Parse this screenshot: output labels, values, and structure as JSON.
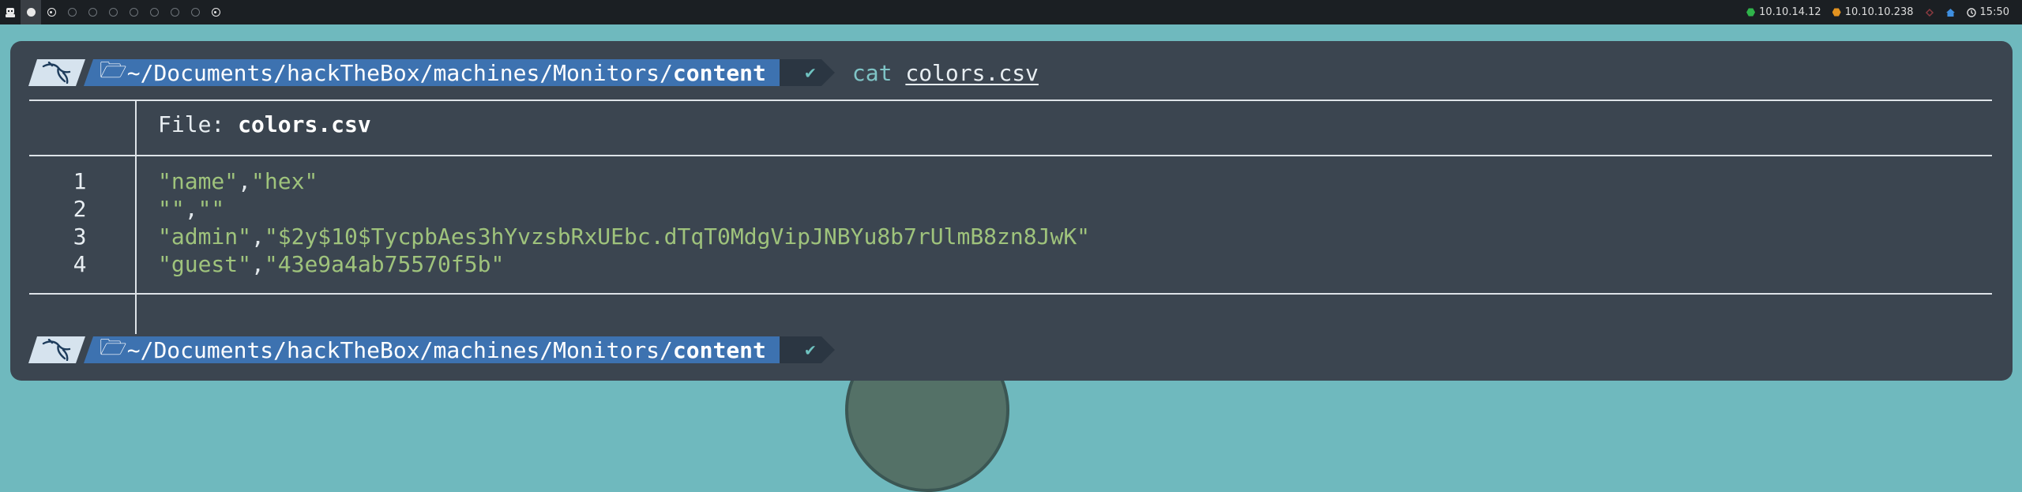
{
  "topbar": {
    "workspaces": [
      {
        "icon": "app-logo-icon",
        "state": "logo"
      },
      {
        "icon": "workspace-1-icon",
        "state": "filled"
      },
      {
        "icon": "workspace-2-icon",
        "state": "ring"
      },
      {
        "icon": "workspace-3-icon",
        "state": "empty"
      },
      {
        "icon": "workspace-4-icon",
        "state": "empty"
      },
      {
        "icon": "workspace-5-icon",
        "state": "empty"
      },
      {
        "icon": "workspace-6-icon",
        "state": "empty"
      },
      {
        "icon": "workspace-7-icon",
        "state": "empty"
      },
      {
        "icon": "workspace-8-icon",
        "state": "empty"
      },
      {
        "icon": "workspace-9-icon",
        "state": "empty"
      },
      {
        "icon": "workspace-10-icon",
        "state": "ring"
      }
    ],
    "local_ip": "10.10.14.12",
    "target_ip": "10.10.10.238",
    "time": "15:50"
  },
  "prompts": [
    {
      "path_prefix": "~/Documents/hackTheBox/machines/Monitors/",
      "path_current": "content",
      "status": "✔",
      "command": "cat",
      "argument": "colors.csv"
    },
    {
      "path_prefix": "~/Documents/hackTheBox/machines/Monitors/",
      "path_current": "content",
      "status": "✔"
    }
  ],
  "output": {
    "file_prefix": "File: ",
    "file_name": "colors.csv",
    "lines": [
      {
        "num": "1",
        "parts": [
          [
            "str",
            "\"name\""
          ],
          [
            "pun",
            ","
          ],
          [
            "str",
            "\"hex\""
          ]
        ]
      },
      {
        "num": "2",
        "parts": [
          [
            "str",
            "\"\""
          ],
          [
            "pun",
            ","
          ],
          [
            "str",
            "\"\""
          ]
        ]
      },
      {
        "num": "3",
        "parts": [
          [
            "str",
            "\"admin\""
          ],
          [
            "pun",
            ","
          ],
          [
            "str",
            "\"$2y$10$TycpbAes3hYvzsbRxUEbc.dTqT0MdgVipJNBYu8b7rUlmB8zn8JwK\""
          ]
        ]
      },
      {
        "num": "4",
        "parts": [
          [
            "str",
            "\"guest\""
          ],
          [
            "pun",
            ","
          ],
          [
            "str",
            "\"43e9a4ab75570f5b\""
          ]
        ]
      }
    ]
  },
  "colors": {
    "background": "#6fb9be",
    "terminal": "#3b4550",
    "path_segment": "#3d72b0",
    "string": "#9fc37c"
  }
}
